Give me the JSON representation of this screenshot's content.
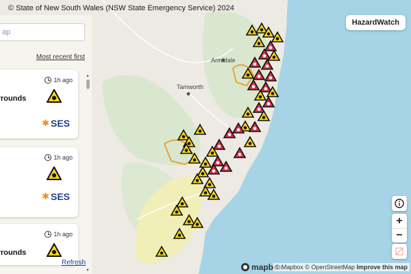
{
  "map": {
    "copyright": "© State of New South Wales (NSW State Emergency Service) 2024",
    "hazard_button": "HazardWatch",
    "places": [
      {
        "name": "Armidale"
      },
      {
        "name": "Tamworth"
      }
    ],
    "zoom_in": "+",
    "zoom_out": "−",
    "mapbox_label": "mapbox",
    "attribution": {
      "mapbox": "© Mapbox",
      "osm": "© OpenStreetMap",
      "improve": "Improve this map"
    },
    "colors": {
      "land": "#eceae2",
      "forest": "#d4e6c9",
      "ocean": "#a7d3e6",
      "yellow_zone": "#f1f0b4",
      "warn_yellow": "#f7d417",
      "warn_red": "#d9304a"
    }
  },
  "panel": {
    "search_placeholder": "ap",
    "sort_label": "Most recent first",
    "refresh_label": "Refresh",
    "cards": [
      {
        "time": "1h ago",
        "title": "urrounds",
        "agency": "SES"
      },
      {
        "time": "1h ago",
        "title": "",
        "agency": "SES"
      },
      {
        "time": "1h ago",
        "title": "urrounds",
        "agency": ""
      }
    ]
  }
}
